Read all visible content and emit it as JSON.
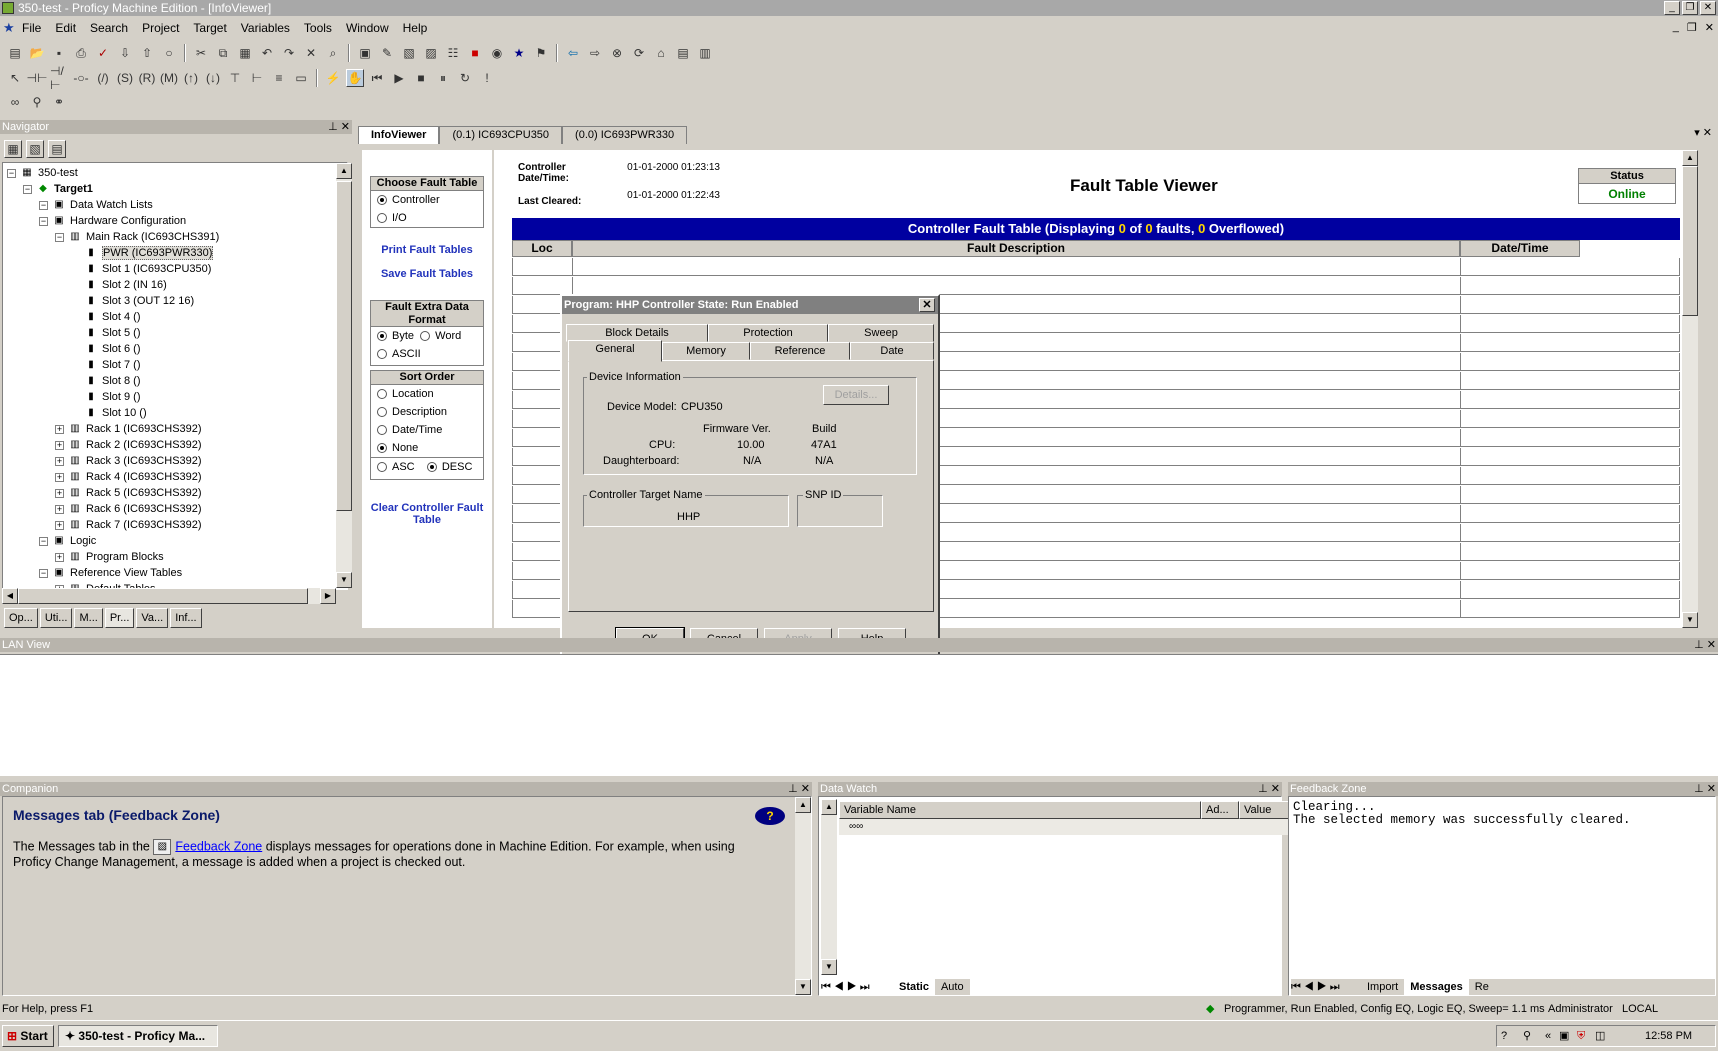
{
  "window": {
    "title": "350-test - Proficy Machine Edition - [InfoViewer]"
  },
  "menu": [
    "File",
    "Edit",
    "Search",
    "Project",
    "Target",
    "Variables",
    "Tools",
    "Window",
    "Help"
  ],
  "navigator": {
    "title": "Navigator",
    "tree": [
      {
        "label": "350-test",
        "level": 0
      },
      {
        "label": "Target1",
        "level": 1,
        "bold": true
      },
      {
        "label": "Data Watch Lists",
        "level": 2
      },
      {
        "label": "Hardware Configuration",
        "level": 2
      },
      {
        "label": "Main Rack (IC693CHS391)",
        "level": 3
      },
      {
        "label": "PWR (IC693PWR330)",
        "level": 4
      },
      {
        "label": "Slot 1 (IC693CPU350)",
        "level": 4
      },
      {
        "label": "Slot 2 (IN 16)",
        "level": 4
      },
      {
        "label": "Slot 3 (OUT 12 16)",
        "level": 4
      },
      {
        "label": "Slot 4 ()",
        "level": 4
      },
      {
        "label": "Slot 5 ()",
        "level": 4
      },
      {
        "label": "Slot 6 ()",
        "level": 4
      },
      {
        "label": "Slot 7 ()",
        "level": 4
      },
      {
        "label": "Slot 8 ()",
        "level": 4
      },
      {
        "label": "Slot 9 ()",
        "level": 4
      },
      {
        "label": "Slot 10 ()",
        "level": 4
      },
      {
        "label": "Rack 1 (IC693CHS392)",
        "level": 3
      },
      {
        "label": "Rack 2 (IC693CHS392)",
        "level": 3
      },
      {
        "label": "Rack 3 (IC693CHS392)",
        "level": 3
      },
      {
        "label": "Rack 4 (IC693CHS392)",
        "level": 3
      },
      {
        "label": "Rack 5 (IC693CHS392)",
        "level": 3
      },
      {
        "label": "Rack 6 (IC693CHS392)",
        "level": 3
      },
      {
        "label": "Rack 7 (IC693CHS392)",
        "level": 3
      },
      {
        "label": "Logic",
        "level": 2
      },
      {
        "label": "Program Blocks",
        "level": 3
      },
      {
        "label": "Reference View Tables",
        "level": 2
      },
      {
        "label": "Default Tables",
        "level": 3
      }
    ],
    "tabs": [
      "Op...",
      "Uti...",
      "M...",
      "Pr...",
      "Va...",
      "Inf..."
    ]
  },
  "doc_tabs": [
    "InfoViewer",
    "(0.1) IC693CPU350",
    "(0.0) IC693PWR330"
  ],
  "left_controls": {
    "choose_fault_table": "Choose Fault Table",
    "controller": "Controller",
    "io": "I/O",
    "print_fault_tables": "Print Fault Tables",
    "save_fault_tables": "Save Fault Tables",
    "fault_extra_data_format": "Fault Extra Data Format",
    "byte": "Byte",
    "word": "Word",
    "ascii": "ASCII",
    "sort_order": "Sort Order",
    "location": "Location",
    "description": "Description",
    "datetime": "Date/Time",
    "none": "None",
    "asc": "ASC",
    "desc": "DESC",
    "clear_controller_fault_table": "Clear Controller Fault Table"
  },
  "fault_viewer": {
    "controller_datetime_label": "Controller Date/Time:",
    "controller_datetime_value": "01-01-2000 01:23:13",
    "last_cleared_label": "Last Cleared:",
    "last_cleared_value": "01-01-2000 01:22:43",
    "title": "Fault Table Viewer",
    "status_label": "Status",
    "status_value": "Online",
    "table_header_prefix": "Controller Fault Table (Displaying ",
    "displayed": "0",
    "of_text": " of ",
    "total": "0",
    "faults_text": " faults, ",
    "overflowed": "0",
    "overflowed_text": " Overflowed)",
    "col_loc": "Loc",
    "col_fault_description": "Fault Description",
    "col_datetime": "Date/Time"
  },
  "dialog": {
    "title": "Program: HHP    Controller State: Run Enabled",
    "tabs_back": [
      "Block Details",
      "Protection",
      "Sweep"
    ],
    "tabs_front": [
      "General",
      "Memory",
      "Reference",
      "Date"
    ],
    "device_information": "Device Information",
    "details_button": "Details...",
    "device_model_label": "Device Model:",
    "device_model_value": "CPU350",
    "firmware_ver": "Firmware Ver.",
    "build": "Build",
    "cpu_label": "CPU:",
    "cpu_fw": "10.00",
    "cpu_build": "47A1",
    "daughterboard_label": "Daughterboard:",
    "db_fw": "N/A",
    "db_build": "N/A",
    "controller_target_name": "Controller Target Name",
    "target_name_value": "HHP",
    "snp_id": "SNP ID",
    "ok": "OK",
    "cancel": "Cancel",
    "apply": "Apply",
    "help": "Help"
  },
  "lan_view": {
    "title": "LAN View"
  },
  "companion": {
    "title": "Companion",
    "heading": "Messages tab (Feedback Zone)",
    "text_before": "The Messages tab in the ",
    "link": "Feedback Zone",
    "text_after": " displays messages for operations done in Machine Edition. For example, when using Proficy Change Management, a message is added when a project is checked out."
  },
  "data_watch": {
    "title": "Data Watch",
    "col_variable": "Variable Name",
    "col_ad": "Ad...",
    "col_value": "Value",
    "tabs": [
      "Static",
      "Auto"
    ]
  },
  "feedback_zone": {
    "title": "Feedback Zone",
    "lines": [
      "Clearing...",
      "The selected memory was successfully cleared."
    ],
    "tabs": [
      "Import",
      "Messages",
      "Re"
    ]
  },
  "status_bar": {
    "help": "For Help, press F1",
    "state": "Programmer, Run Enabled, Config EQ, Logic EQ, Sweep=  1.1 ms",
    "user": "Administrator",
    "location": "LOCAL"
  },
  "taskbar": {
    "start": "Start",
    "task": "350-test - Proficy Ma...",
    "time": "12:58 PM"
  },
  "colors": {
    "online": "#008000",
    "table_header": "#0000a0",
    "highlight": "#ffd700",
    "link": "#2233bb"
  }
}
